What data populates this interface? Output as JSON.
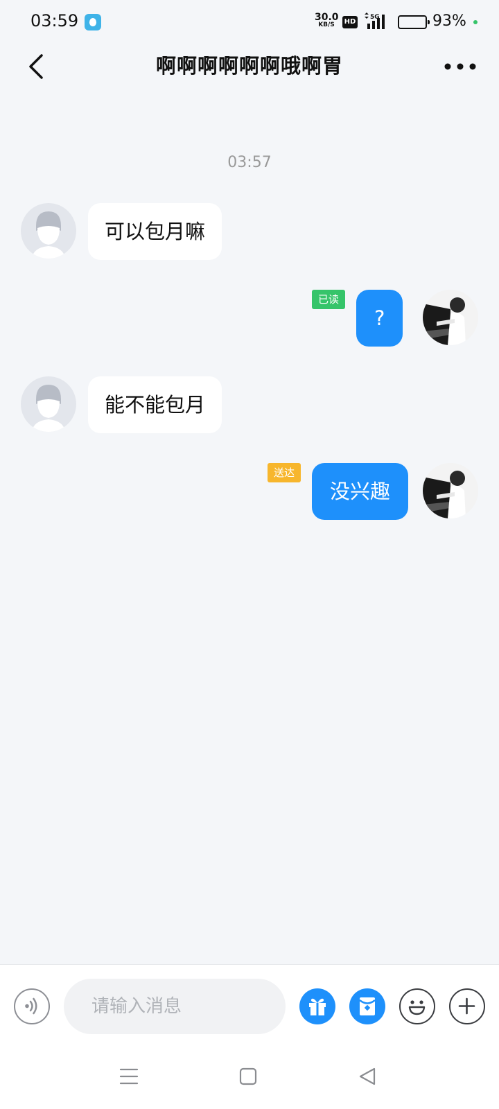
{
  "status_bar": {
    "time": "03:59",
    "net_speed_value": "30.0",
    "net_speed_unit": "KB/S",
    "hd_label": "HD",
    "network_label": "5G",
    "battery_percent": "93%",
    "battery_level": 0.93
  },
  "header": {
    "title": "啊啊啊啊啊啊哦啊胃"
  },
  "chat": {
    "timestamp": "03:57",
    "messages": [
      {
        "direction": "incoming",
        "text": "可以包月嘛"
      },
      {
        "direction": "outgoing",
        "text": "?",
        "status": "已读"
      },
      {
        "direction": "incoming",
        "text": "能不能包月"
      },
      {
        "direction": "outgoing",
        "text": "没兴趣",
        "status": "送达"
      }
    ]
  },
  "input_bar": {
    "placeholder": "请输入消息",
    "icons": [
      "voice-icon",
      "gift-icon",
      "red-packet-icon",
      "emoji-icon",
      "plus-icon"
    ]
  },
  "system_nav": {
    "icons": [
      "menu-icon",
      "home-icon",
      "back-icon"
    ]
  },
  "colors": {
    "background": "#f4f6f9",
    "outgoing_bubble": "#1e90fb",
    "incoming_bubble": "#ffffff",
    "read_tag": "#35c46a",
    "delivered_tag": "#f7b62d"
  }
}
